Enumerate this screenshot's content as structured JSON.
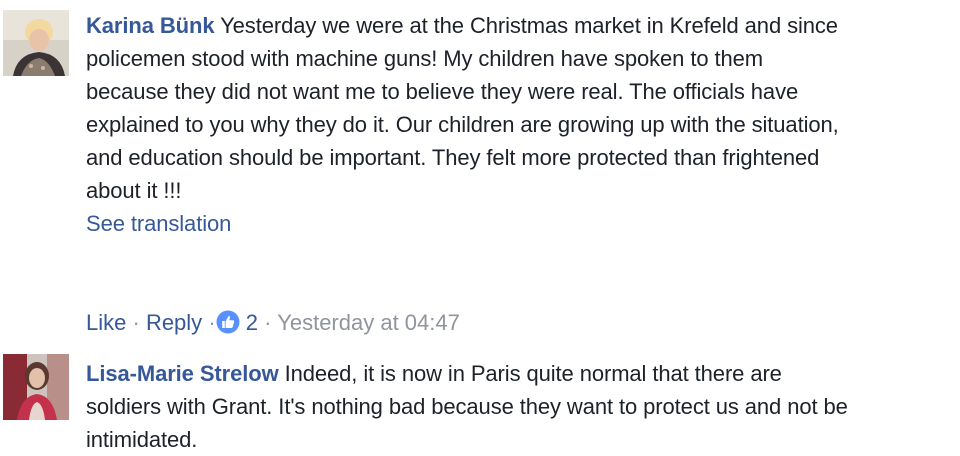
{
  "comments": [
    {
      "author": "Karina Bünk",
      "lines": [
        "Yesterday we were at the Christmas market in Krefeld and since",
        "policemen stood with machine guns! My children have spoken to them",
        "because they did not want me to believe they were real. The officials have",
        "explained to you why they do it. Our children are growing up with the situation,",
        "and education should be important. They felt more protected than frightened",
        "about it !!!"
      ],
      "see_translation": "See translation",
      "actions": {
        "like": "Like",
        "separator": "·",
        "reply": "Reply",
        "reaction_count": "2",
        "timestamp": "Yesterday at 04:47"
      }
    },
    {
      "author": "Lisa-Marie Strelow",
      "lines": [
        "Indeed, it is now in Paris quite normal that there are",
        "soldiers with Grant. It's nothing bad because they want to protect us and not be",
        "intimidated."
      ]
    }
  ],
  "colors": {
    "author_link": "#365899",
    "text": "#1d2129",
    "meta_gray": "#90949c",
    "like_reaction": "#5890ff"
  },
  "icons": {
    "reaction": "thumbs-up-icon"
  }
}
